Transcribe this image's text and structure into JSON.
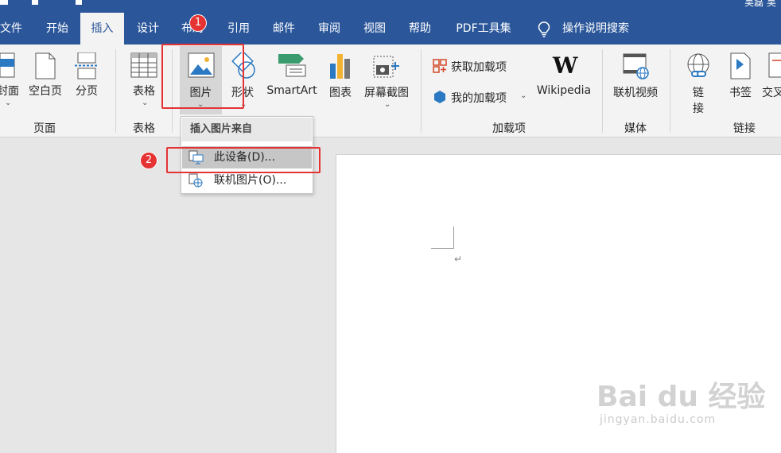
{
  "titlebar": {
    "right_text": "吴磊  吴"
  },
  "menu": {
    "tabs": [
      "文件",
      "开始",
      "插入",
      "设计",
      "布局",
      "引用",
      "邮件",
      "审阅",
      "视图",
      "帮助",
      "PDF工具集"
    ],
    "active": "插入",
    "tell_me": "操作说明搜索"
  },
  "ribbon": {
    "page_group": {
      "cover": "封面",
      "blank": "空白页",
      "break": "分页",
      "label": "页面"
    },
    "table_group": {
      "table": "表格",
      "label": "表格"
    },
    "illus_group": {
      "pictures": "图片",
      "shapes": "形状",
      "smartart": "SmartArt",
      "chart": "图表",
      "screenshot": "屏幕截图"
    },
    "addins_group": {
      "get": "获取加载项",
      "mine": "我的加载项",
      "wikipedia": "Wikipedia",
      "wiki_logo": "W",
      "label": "加载项"
    },
    "media_group": {
      "video": "联机视频",
      "label": "媒体"
    },
    "links_group": {
      "link": "链接",
      "link_line1": "链",
      "link_line2": "接",
      "bookmark": "书签",
      "cross": "交叉",
      "label": "链接"
    }
  },
  "dropdown": {
    "header": "插入图片来自",
    "items": [
      "此设备(D)...",
      "联机图片(O)..."
    ]
  },
  "annotations": {
    "step1": "1",
    "step2": "2",
    "accent": "#e53333"
  },
  "document": {
    "para_mark": "↵"
  },
  "watermark": {
    "brand": "Bai du 经验",
    "url": "jingyan.baidu.com"
  },
  "colors": {
    "brand": "#2b579a",
    "ribbon": "#f3f3f3",
    "highlight": "#c6c6c6"
  }
}
